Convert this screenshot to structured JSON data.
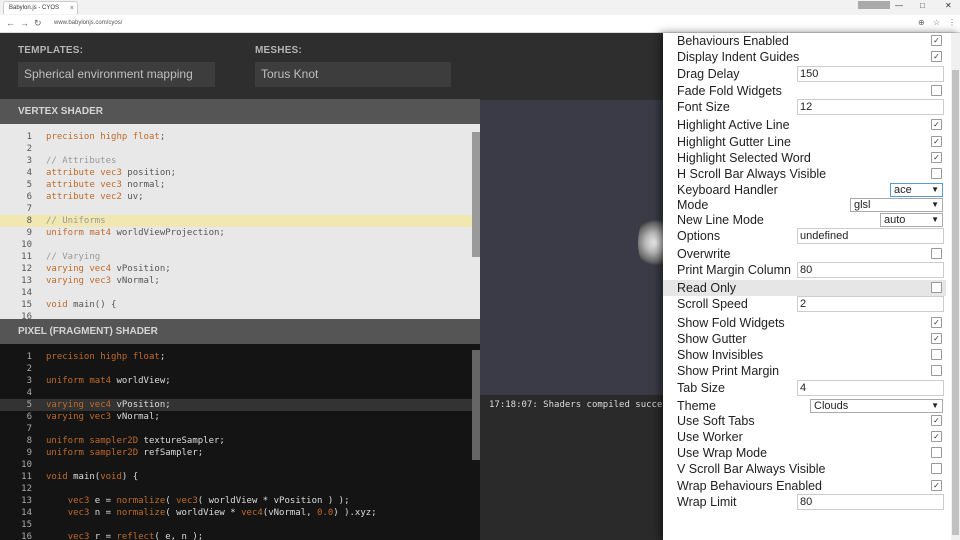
{
  "browser": {
    "tab_title": "Babylon.js - CYOS",
    "tab_close": "×",
    "profile_label": "",
    "win_min": "—",
    "win_max": "□",
    "win_close": "✕",
    "url": "www.babylonjs.com/cyos/",
    "nav_back": "←",
    "nav_forward": "→",
    "nav_reload": "↻"
  },
  "header": {
    "templates_label": "TEMPLATES:",
    "templates_value": "Spherical environment mapping",
    "meshes_label": "MESHES:",
    "meshes_value": "Torus Knot"
  },
  "vertex": {
    "title": "VERTEX SHADER",
    "lines": [
      {
        "n": "1",
        "t": "precision highp float;"
      },
      {
        "n": "2",
        "t": ""
      },
      {
        "n": "3",
        "t": "// Attributes"
      },
      {
        "n": "4",
        "t": "attribute vec3 position;"
      },
      {
        "n": "5",
        "t": "attribute vec3 normal;"
      },
      {
        "n": "6",
        "t": "attribute vec2 uv;"
      },
      {
        "n": "7",
        "t": ""
      },
      {
        "n": "8",
        "t": "// Uniforms"
      },
      {
        "n": "9",
        "t": "uniform mat4 worldViewProjection;"
      },
      {
        "n": "10",
        "t": ""
      },
      {
        "n": "11",
        "t": "// Varying"
      },
      {
        "n": "12",
        "t": "varying vec4 vPosition;"
      },
      {
        "n": "13",
        "t": "varying vec3 vNormal;"
      },
      {
        "n": "14",
        "t": ""
      },
      {
        "n": "15",
        "t": "void main() {"
      },
      {
        "n": "16",
        "t": ""
      }
    ]
  },
  "fragment": {
    "title": "PIXEL (FRAGMENT) SHADER",
    "lines": [
      {
        "n": "1",
        "t": "precision highp float;"
      },
      {
        "n": "2",
        "t": ""
      },
      {
        "n": "3",
        "t": "uniform mat4 worldView;"
      },
      {
        "n": "4",
        "t": ""
      },
      {
        "n": "5",
        "t": "varying vec4 vPosition;"
      },
      {
        "n": "6",
        "t": "varying vec3 vNormal;"
      },
      {
        "n": "7",
        "t": ""
      },
      {
        "n": "8",
        "t": "uniform sampler2D textureSampler;"
      },
      {
        "n": "9",
        "t": "uniform sampler2D refSampler;"
      },
      {
        "n": "10",
        "t": ""
      },
      {
        "n": "11",
        "t": "void main(void) {"
      },
      {
        "n": "12",
        "t": ""
      },
      {
        "n": "13",
        "t": "    vec3 e = normalize( vec3( worldView * vPosition ) );"
      },
      {
        "n": "14",
        "t": "    vec3 n = normalize( worldView * vec4(vNormal, 0.0) ).xyz;"
      },
      {
        "n": "15",
        "t": ""
      },
      {
        "n": "16",
        "t": "    vec3 r = reflect( e, n );"
      }
    ]
  },
  "console": {
    "message": "17:18:07: Shaders compiled successfully"
  },
  "settings": {
    "rows": [
      {
        "label": "Behaviours Enabled",
        "kind": "check",
        "checked": true
      },
      {
        "label": "Display Indent Guides",
        "kind": "check",
        "checked": true
      },
      {
        "label": "Drag Delay",
        "kind": "text",
        "value": "150"
      },
      {
        "label": "Fade Fold Widgets",
        "kind": "check",
        "checked": false
      },
      {
        "label": "Font Size",
        "kind": "text",
        "value": "12"
      },
      {
        "label": "Highlight Active Line",
        "kind": "check",
        "checked": true
      },
      {
        "label": "Highlight Gutter Line",
        "kind": "check",
        "checked": true
      },
      {
        "label": "Highlight Selected Word",
        "kind": "check",
        "checked": true
      },
      {
        "label": "H Scroll Bar Always Visible",
        "kind": "check",
        "checked": false
      },
      {
        "label": "Keyboard Handler",
        "kind": "select",
        "value": "ace"
      },
      {
        "label": "Mode",
        "kind": "select",
        "value": "glsl"
      },
      {
        "label": "New Line Mode",
        "kind": "select",
        "value": "auto"
      },
      {
        "label": "Options",
        "kind": "text",
        "value": "undefined"
      },
      {
        "label": "Overwrite",
        "kind": "check",
        "checked": false
      },
      {
        "label": "Print Margin Column",
        "kind": "text",
        "value": "80"
      },
      {
        "label": "Read Only",
        "kind": "check",
        "checked": false
      },
      {
        "label": "Scroll Speed",
        "kind": "text",
        "value": "2"
      },
      {
        "label": "Show Fold Widgets",
        "kind": "check",
        "checked": true
      },
      {
        "label": "Show Gutter",
        "kind": "check",
        "checked": true
      },
      {
        "label": "Show Invisibles",
        "kind": "check",
        "checked": false
      },
      {
        "label": "Show Print Margin",
        "kind": "check",
        "checked": false
      },
      {
        "label": "Tab Size",
        "kind": "text",
        "value": "4"
      },
      {
        "label": "Theme",
        "kind": "select",
        "value": "Clouds"
      },
      {
        "label": "Use Soft Tabs",
        "kind": "check",
        "checked": true
      },
      {
        "label": "Use Worker",
        "kind": "check",
        "checked": true
      },
      {
        "label": "Use Wrap Mode",
        "kind": "check",
        "checked": false
      },
      {
        "label": "V Scroll Bar Always Visible",
        "kind": "check",
        "checked": false
      },
      {
        "label": "Wrap Behaviours Enabled",
        "kind": "check",
        "checked": true
      },
      {
        "label": "Wrap Limit",
        "kind": "text",
        "value": "80"
      }
    ]
  }
}
